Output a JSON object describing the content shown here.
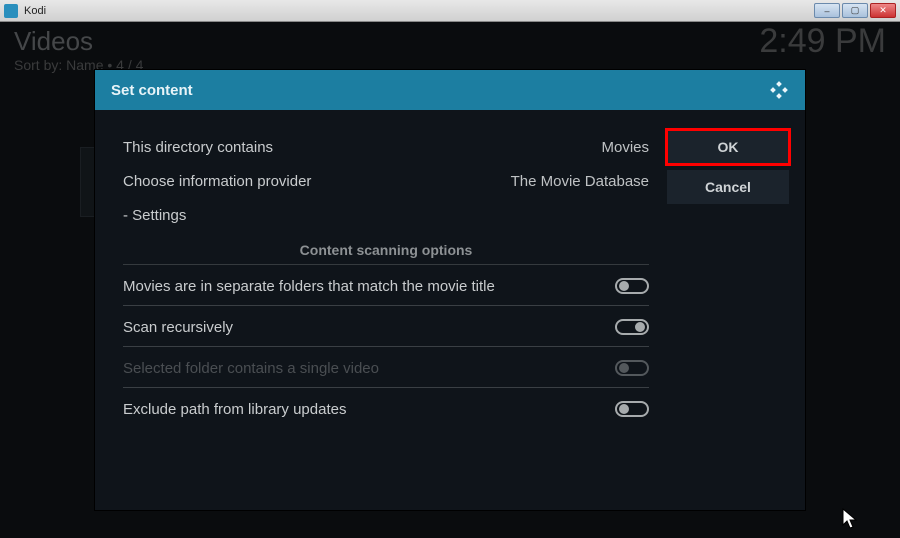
{
  "window": {
    "app_title": "Kodi"
  },
  "background": {
    "title": "Videos",
    "sort_line": "Sort by: Name  •  4 / 4",
    "clock": "2:49 PM"
  },
  "dialog": {
    "title": "Set content",
    "rows": {
      "directory_label": "This directory contains",
      "directory_value": "Movies",
      "provider_label": "Choose information provider",
      "provider_value": "The Movie Database",
      "settings_label": "- Settings"
    },
    "section_header": "Content scanning options",
    "options": {
      "separate_folders": "Movies are in separate folders that match the movie title",
      "scan_recursively": "Scan recursively",
      "single_video": "Selected folder contains a single video",
      "exclude_path": "Exclude path from library updates"
    },
    "buttons": {
      "ok": "OK",
      "cancel": "Cancel"
    }
  },
  "option_states": {
    "separate_folders": "off",
    "scan_recursively": "on",
    "single_video": "off",
    "exclude_path": "off"
  }
}
